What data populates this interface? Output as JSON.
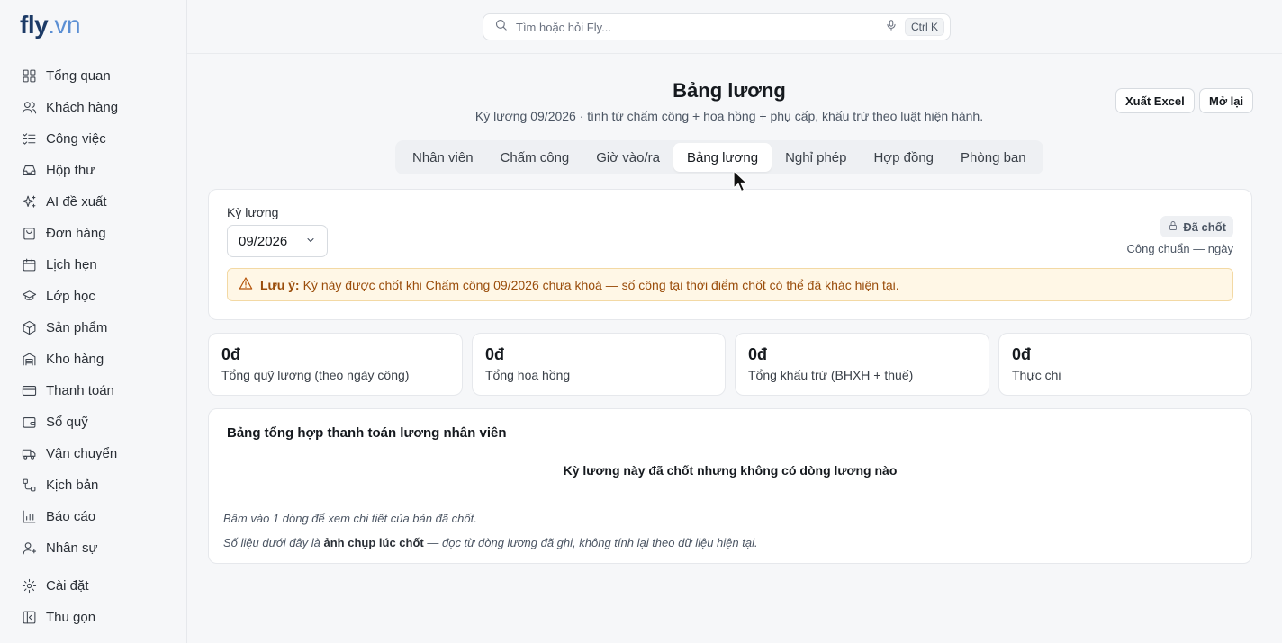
{
  "brand": {
    "name_main": "fly",
    "name_suffix": ".vn"
  },
  "sidebar": {
    "items": [
      {
        "label": "Tổng quan",
        "icon": "grid-icon"
      },
      {
        "label": "Khách hàng",
        "icon": "users-icon"
      },
      {
        "label": "Công việc",
        "icon": "checklist-icon"
      },
      {
        "label": "Hộp thư",
        "icon": "inbox-icon"
      },
      {
        "label": "AI đề xuất",
        "icon": "sparkles-icon"
      },
      {
        "label": "Đơn hàng",
        "icon": "bag-icon"
      },
      {
        "label": "Lịch hẹn",
        "icon": "calendar-icon"
      },
      {
        "label": "Lớp học",
        "icon": "graduation-cap-icon"
      },
      {
        "label": "Sản phẩm",
        "icon": "box-icon"
      },
      {
        "label": "Kho hàng",
        "icon": "warehouse-icon"
      },
      {
        "label": "Thanh toán",
        "icon": "credit-card-icon"
      },
      {
        "label": "Sổ quỹ",
        "icon": "wallet-icon"
      },
      {
        "label": "Vận chuyển",
        "icon": "truck-icon"
      },
      {
        "label": "Kịch bản",
        "icon": "workflow-icon"
      },
      {
        "label": "Báo cáo",
        "icon": "bar-chart-icon"
      },
      {
        "label": "Nhân sự",
        "icon": "user-icon"
      }
    ],
    "settings": "Cài đặt",
    "collapse": "Thu gọn"
  },
  "search": {
    "placeholder": "Tìm hoặc hỏi Fly...",
    "shortcut": "Ctrl K"
  },
  "header": {
    "title": "Bảng lương",
    "subtitle": "Kỳ lương 09/2026 · tính từ chấm công + hoa hồng + phụ cấp, khấu trừ theo luật hiện hành.",
    "export_label": "Xuất Excel",
    "reopen_label": "Mở lại"
  },
  "tabs": [
    "Nhân viên",
    "Chấm công",
    "Giờ vào/ra",
    "Bảng lương",
    "Nghỉ phép",
    "Hợp đồng",
    "Phòng ban"
  ],
  "active_tab": "Bảng lương",
  "period": {
    "label": "Kỳ lương",
    "value": "09/2026",
    "status": "Đã chốt",
    "standard_days": "Công chuẩn — ngày"
  },
  "warning": {
    "prefix": "Lưu ý:",
    "text": "Kỳ này được chốt khi Chấm công 09/2026 chưa khoá — số công tại thời điểm chốt có thể đã khác hiện tại."
  },
  "stats": [
    {
      "value": "0đ",
      "label": "Tổng quỹ lương (theo ngày công)"
    },
    {
      "value": "0đ",
      "label": "Tổng hoa hồng"
    },
    {
      "value": "0đ",
      "label": "Tổng khấu trừ (BHXH + thuế)"
    },
    {
      "value": "0đ",
      "label": "Thực chi"
    }
  ],
  "summary": {
    "title": "Bảng tổng hợp thanh toán lương nhân viên",
    "empty": "Kỳ lương này đã chốt nhưng không có dòng lương nào",
    "note1": "Bấm vào 1 dòng để xem chi tiết của bản đã chốt.",
    "note2_pre": "Số liệu dưới đây là",
    "note2_bold": "ảnh chụp lúc chốt",
    "note2_post": "— đọc từ dòng lương đã ghi, không tính lại theo dữ liệu hiện tại."
  },
  "colors": {
    "brand": "#1c3a66",
    "brand_accent": "#5b8fd4",
    "warning_bg": "#fff7e6",
    "warning_text": "#9a4d0b"
  }
}
